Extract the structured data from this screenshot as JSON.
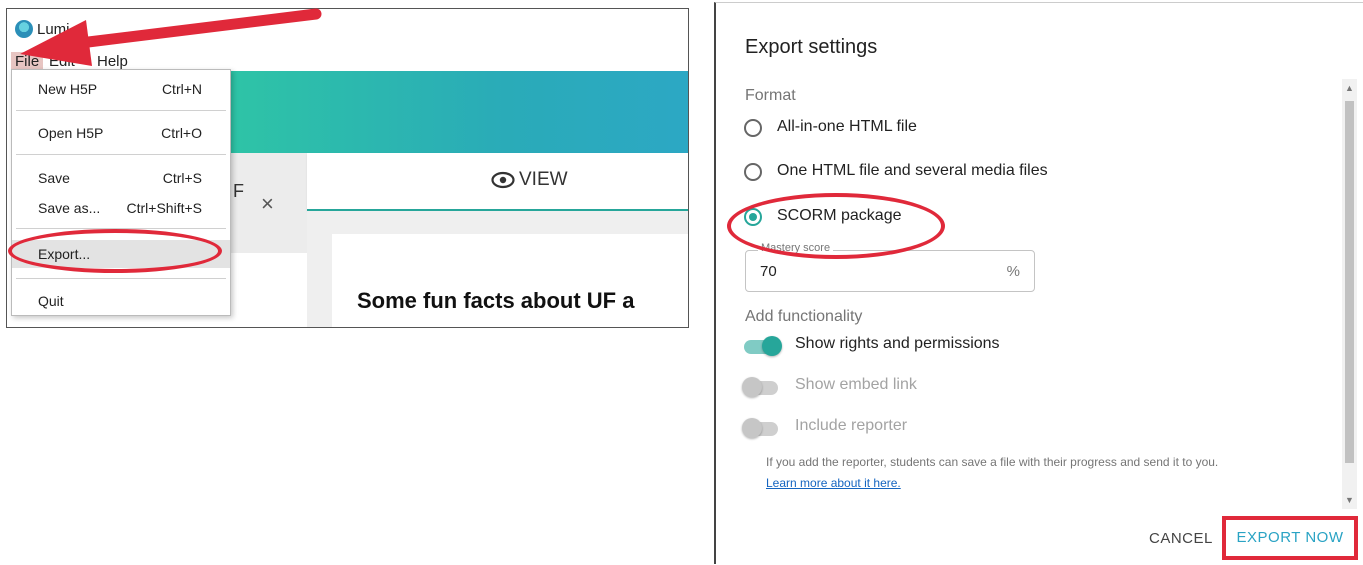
{
  "lumi": {
    "app_title": "Lumi",
    "menubar": {
      "file": "File",
      "edit": "Edit",
      "help": "Help"
    },
    "file_menu": [
      {
        "label": "New H5P",
        "shortcut": "Ctrl+N"
      },
      {
        "label": "Open H5P",
        "shortcut": "Ctrl+O"
      },
      {
        "label": "Save",
        "shortcut": "Ctrl+S"
      },
      {
        "label": "Save as...",
        "shortcut": "Ctrl+Shift+S"
      },
      {
        "label": "Export...",
        "shortcut": ""
      },
      {
        "label": "Quit",
        "shortcut": ""
      }
    ],
    "tab_fragment": "F",
    "close_glyph": "×",
    "view_label": "VIEW",
    "content_heading": "Some fun facts about UF a",
    "accent_colors": {
      "teal_start": "#2ec4a6",
      "teal_end": "#2ca8c4",
      "annotation_red": "#e0293a"
    }
  },
  "export_dialog": {
    "title": "Export settings",
    "format_label": "Format",
    "formats": [
      {
        "label": "All-in-one HTML file",
        "selected": false
      },
      {
        "label": "One HTML file and several media files",
        "selected": false
      },
      {
        "label": "SCORM package",
        "selected": true
      }
    ],
    "mastery": {
      "legend": "Mastery score",
      "value": "70",
      "unit": "%"
    },
    "functionality_label": "Add functionality",
    "toggles": [
      {
        "label": "Show rights and permissions",
        "on": true
      },
      {
        "label": "Show embed link",
        "on": false
      },
      {
        "label": "Include reporter",
        "on": false
      }
    ],
    "help_text": "If you add the reporter, students can save a file with their progress and send it to you.",
    "help_link": "Learn more about it here.",
    "cancel_label": "CANCEL",
    "export_label": "EXPORT NOW",
    "accent_color": "#26a69a"
  }
}
